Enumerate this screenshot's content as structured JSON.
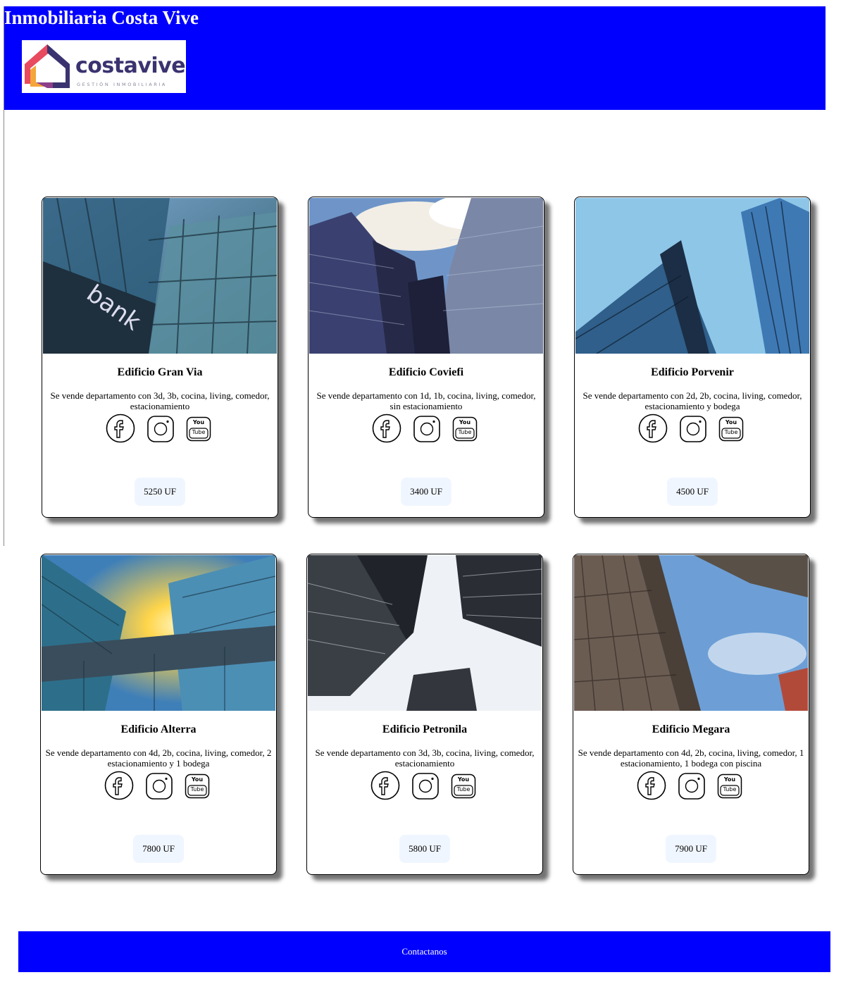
{
  "header": {
    "title": "Inmobiliaria Costa Vive",
    "logo": {
      "name": "costavive",
      "tagline": "GESTIÓN INMOBILIARIA"
    }
  },
  "cards": [
    {
      "name": "Edificio Gran Via",
      "description": "Se vende departamento con 3d, 3b, cocina, living, comedor, estacionamiento",
      "price": "5250 UF"
    },
    {
      "name": "Edificio Coviefi",
      "description": "Se vende departamento con 1d, 1b, cocina, living, comedor, sin estacionamiento",
      "price": "3400 UF"
    },
    {
      "name": "Edificio Porvenir",
      "description": "Se vende departamento con 2d, 2b, cocina, living, comedor, estacionamiento y bodega",
      "price": "4500 UF"
    },
    {
      "name": "Edificio Alterra",
      "description": "Se vende departamento con 4d, 2b, cocina, living, comedor, 2 estacionamiento y 1 bodega",
      "price": "7800 UF"
    },
    {
      "name": "Edificio Petronila",
      "description": "Se vende departamento con 3d, 3b, cocina, living, comedor, estacionamiento",
      "price": "5800 UF"
    },
    {
      "name": "Edificio Megara",
      "description": "Se vende departamento con 4d, 2b, cocina, living, comedor, 1 estacionamiento, 1 bodega con piscina",
      "price": "7900 UF"
    }
  ],
  "social_icons": [
    "facebook-icon",
    "instagram-icon",
    "youtube-icon"
  ],
  "youtube_text": {
    "top": "You",
    "bottom": "Tube"
  },
  "footer": {
    "contact_label": "Contactanos"
  },
  "colors": {
    "brand_blue": "#0000ff",
    "logo_purple": "#3a3370",
    "price_bg": "#f0f6ff"
  }
}
